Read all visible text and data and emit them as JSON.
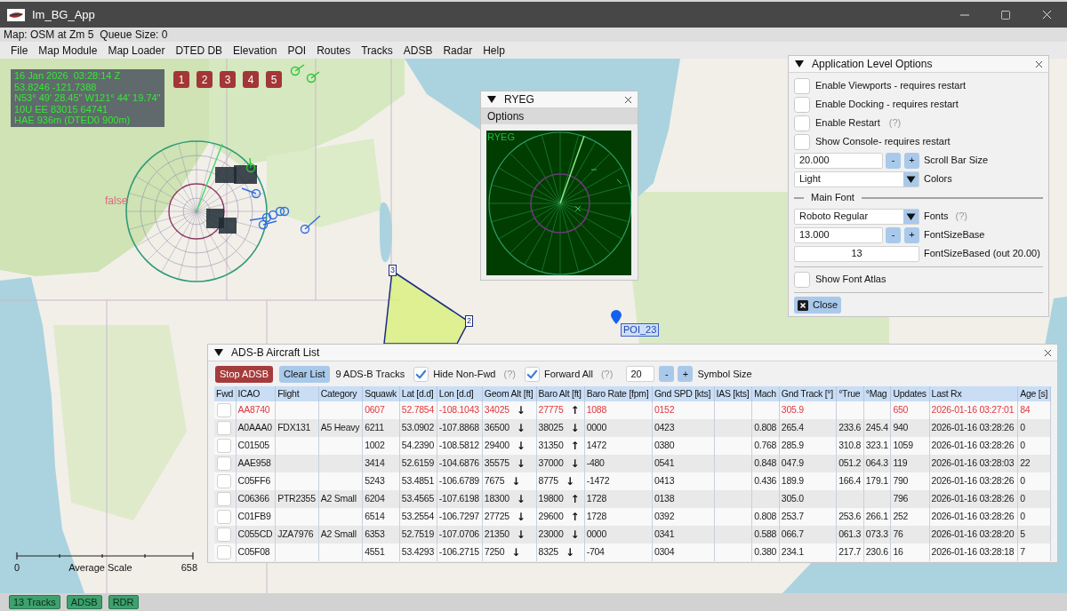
{
  "window": {
    "title": "Im_BG_App"
  },
  "status_line": [
    "Map: OSM at Zm 5",
    "Queue Size: 0"
  ],
  "menu": [
    "File",
    "Map Module",
    "Map Loader",
    "DTED DB",
    "Elevation",
    "POI",
    "Routes",
    "Tracks",
    "ADSB",
    "Radar",
    "Help"
  ],
  "map": {
    "info_lines": [
      "16 Jan 2026  03:28:14 Z",
      "53.8246 -121.7388",
      "N53° 49' 28.45\" W121° 44' 19.74\"",
      "10U EE 83015 64741",
      "HAE 936m (DTED0 900m)"
    ],
    "quick_buttons": [
      "1",
      "2",
      "3",
      "4",
      "5"
    ],
    "flag_label": "false",
    "waypoints": [
      {
        "label": "3"
      },
      {
        "label": "2"
      }
    ],
    "poi": {
      "label": "POI_23"
    },
    "scale": {
      "start": "0",
      "label": "Average Scale",
      "end": "658"
    }
  },
  "radar_window": {
    "title": "RYEG",
    "menu": "Options",
    "scope_label": "RYEG"
  },
  "options_window": {
    "title": "Application Level Options",
    "items": [
      {
        "kind": "checkbox",
        "label": "Enable Viewports - requires restart",
        "checked": false
      },
      {
        "kind": "checkbox",
        "label": "Enable Docking - requires restart",
        "checked": false
      },
      {
        "kind": "checkbox",
        "label": "Enable Restart",
        "help": "(?)",
        "checked": false
      },
      {
        "kind": "checkbox",
        "label": "Show Console- requires restart",
        "checked": false
      },
      {
        "kind": "stepper",
        "entry": "20.000",
        "minus": "-",
        "plus": "+",
        "label": "Scroll Bar Size"
      },
      {
        "kind": "combo",
        "selection": "Light",
        "label": "Colors"
      },
      {
        "kind": "section",
        "label": "Main Font"
      },
      {
        "kind": "combo",
        "selection": "Roboto Regular",
        "label": "Fonts",
        "help": "(?)"
      },
      {
        "kind": "stepper",
        "entry": "13.000",
        "minus": "-",
        "plus": "+",
        "label": "FontSizeBase"
      },
      {
        "kind": "drag",
        "entry": "13",
        "label": "FontSizeBased (out 20.00)"
      },
      {
        "kind": "divider"
      },
      {
        "kind": "checkbox",
        "label": "Show Font Atlas",
        "checked": false
      },
      {
        "kind": "divider"
      }
    ],
    "close_button": "Close"
  },
  "adsb_window": {
    "title": "ADS-B Aircraft List",
    "toolbar": {
      "stop_button": "Stop ADSB",
      "clear_button": "Clear List",
      "track_count": "9 ADS-B Tracks",
      "toggles": [
        {
          "label": "Hide Non-Fwd",
          "checked": true,
          "help": "(?)"
        },
        {
          "label": "Forward All",
          "checked": true,
          "help": "(?)"
        }
      ],
      "symbol_size": {
        "value": "20",
        "minus": "-",
        "plus": "+",
        "label": "Symbol Size"
      }
    },
    "table": {
      "columns": [
        "Fwd",
        "ICAO",
        "Flight",
        "Category",
        "Squawk",
        "Lat [d.d]",
        "Lon [d.d]",
        "Geom Alt [ft]",
        "Baro Alt [ft]",
        "Baro Rate [fpm]",
        "Gnd SPD [kts]",
        "IAS [kts]",
        "Mach",
        "Gnd Track [°]",
        "°True",
        "°Mag",
        "Updates",
        "Last Rx",
        "Age [s]"
      ],
      "rows": [
        {
          "fwd": false,
          "stale": true,
          "icao": "AA8740",
          "squawk": "0607",
          "lat": "52.7854",
          "lon": "-108.1043",
          "geom_alt": "34025",
          "geom_alt_arrow": "↓",
          "baro_alt": "27775",
          "baro_alt_arrow": "↑",
          "baro_rate": "1088",
          "gnd_spd": "0152",
          "gnd_track": "305.9",
          "updates": "650",
          "last_rx": "2026-01-16 03:27:01",
          "age": "84"
        },
        {
          "fwd": false,
          "stale": false,
          "icao": "A0AAA0",
          "flight": "FDX131",
          "category": "A5 Heavy",
          "squawk": "6211",
          "lat": "53.0902",
          "lon": "-107.8868",
          "geom_alt": "36500",
          "geom_alt_arrow": "↓",
          "baro_alt": "38025",
          "baro_alt_arrow": "↓",
          "baro_rate": "0000",
          "gnd_spd": "0423",
          "mach": "0.808",
          "gnd_track": "265.4",
          "true_heading": "233.6",
          "mag_heading": "245.4",
          "updates": "940",
          "last_rx": "2026-01-16 03:28:26",
          "age": "0"
        },
        {
          "fwd": false,
          "stale": false,
          "icao": "C01505",
          "squawk": "1002",
          "lat": "54.2390",
          "lon": "-108.5812",
          "geom_alt": "29400",
          "geom_alt_arrow": "↓",
          "baro_alt": "31350",
          "baro_alt_arrow": "↑",
          "baro_rate": "1472",
          "gnd_spd": "0380",
          "mach": "0.768",
          "gnd_track": "285.9",
          "true_heading": "310.8",
          "mag_heading": "323.1",
          "updates": "1059",
          "last_rx": "2026-01-16 03:28:26",
          "age": "0"
        },
        {
          "fwd": false,
          "stale": false,
          "icao": "AAE958",
          "squawk": "3414",
          "lat": "52.6159",
          "lon": "-104.6876",
          "geom_alt": "35575",
          "geom_alt_arrow": "↓",
          "baro_alt": "37000",
          "baro_alt_arrow": "↓",
          "baro_rate": "-480",
          "gnd_spd": "0541",
          "mach": "0.848",
          "gnd_track": "047.9",
          "true_heading": "051.2",
          "mag_heading": "064.3",
          "updates": "119",
          "last_rx": "2026-01-16 03:28:03",
          "age": "22"
        },
        {
          "fwd": false,
          "stale": false,
          "icao": "C05FF6",
          "squawk": "5243",
          "lat": "53.4851",
          "lon": "-106.6789",
          "geom_alt": "7675",
          "geom_alt_arrow": "↓",
          "baro_alt": "8775",
          "baro_alt_arrow": "↓",
          "baro_rate": "-1472",
          "gnd_spd": "0413",
          "mach": "0.436",
          "gnd_track": "189.9",
          "true_heading": "166.4",
          "mag_heading": "179.1",
          "updates": "790",
          "last_rx": "2026-01-16 03:28:26",
          "age": "0"
        },
        {
          "fwd": false,
          "stale": false,
          "icao": "C06366",
          "flight": "PTR2355",
          "category": "A2 Small",
          "squawk": "6204",
          "lat": "53.4565",
          "lon": "-107.6198",
          "geom_alt": "18300",
          "geom_alt_arrow": "↓",
          "baro_alt": "19800",
          "baro_alt_arrow": "↑",
          "baro_rate": "1728",
          "gnd_spd": "0138",
          "gnd_track": "305.0",
          "updates": "796",
          "last_rx": "2026-01-16 03:28:26",
          "age": "0"
        },
        {
          "fwd": false,
          "stale": false,
          "icao": "C01FB9",
          "squawk": "6514",
          "lat": "53.2554",
          "lon": "-106.7297",
          "geom_alt": "27725",
          "geom_alt_arrow": "↓",
          "baro_alt": "29600",
          "baro_alt_arrow": "↑",
          "baro_rate": "1728",
          "gnd_spd": "0392",
          "mach": "0.808",
          "gnd_track": "253.7",
          "true_heading": "253.6",
          "mag_heading": "266.1",
          "updates": "252",
          "last_rx": "2026-01-16 03:28:26",
          "age": "0"
        },
        {
          "fwd": false,
          "stale": false,
          "icao": "C055CD",
          "flight": "JZA7976",
          "category": "A2 Small",
          "squawk": "6353",
          "lat": "52.7519",
          "lon": "-107.0706",
          "geom_alt": "21350",
          "geom_alt_arrow": "↓",
          "baro_alt": "23000",
          "baro_alt_arrow": "↓",
          "baro_rate": "0000",
          "gnd_spd": "0341",
          "mach": "0.588",
          "gnd_track": "066.7",
          "true_heading": "061.3",
          "mag_heading": "073.3",
          "updates": "76",
          "last_rx": "2026-01-16 03:28:20",
          "age": "5"
        },
        {
          "fwd": false,
          "stale": false,
          "icao": "C05F08",
          "squawk": "4551",
          "lat": "53.4293",
          "lon": "-106.2715",
          "geom_alt": "7250",
          "geom_alt_arrow": "↓",
          "baro_alt": "8325",
          "baro_alt_arrow": "↓",
          "baro_rate": "-704",
          "gnd_spd": "0304",
          "mach": "0.380",
          "gnd_track": "234.1",
          "true_heading": "217.7",
          "mag_heading": "230.6",
          "updates": "16",
          "last_rx": "2026-01-16 03:28:18",
          "age": "7"
        }
      ]
    }
  },
  "status_bar": [
    "13 Tracks",
    "ADSB",
    "RDR"
  ]
}
